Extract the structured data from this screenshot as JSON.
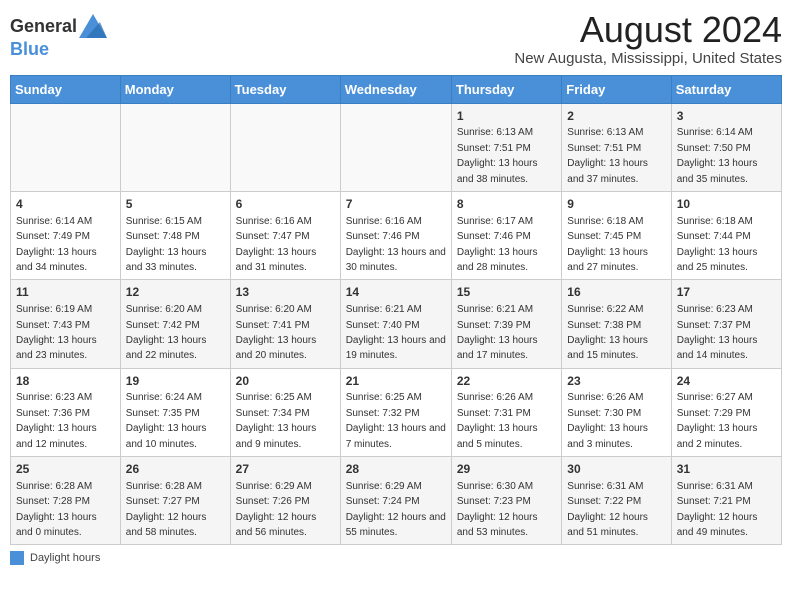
{
  "logo": {
    "line1": "General",
    "line2": "Blue"
  },
  "title": "August 2024",
  "subtitle": "New Augusta, Mississippi, United States",
  "days_of_week": [
    "Sunday",
    "Monday",
    "Tuesday",
    "Wednesday",
    "Thursday",
    "Friday",
    "Saturday"
  ],
  "weeks": [
    [
      {
        "day": "",
        "info": ""
      },
      {
        "day": "",
        "info": ""
      },
      {
        "day": "",
        "info": ""
      },
      {
        "day": "",
        "info": ""
      },
      {
        "day": "1",
        "info": "Sunrise: 6:13 AM\nSunset: 7:51 PM\nDaylight: 13 hours and 38 minutes."
      },
      {
        "day": "2",
        "info": "Sunrise: 6:13 AM\nSunset: 7:51 PM\nDaylight: 13 hours and 37 minutes."
      },
      {
        "day": "3",
        "info": "Sunrise: 6:14 AM\nSunset: 7:50 PM\nDaylight: 13 hours and 35 minutes."
      }
    ],
    [
      {
        "day": "4",
        "info": "Sunrise: 6:14 AM\nSunset: 7:49 PM\nDaylight: 13 hours and 34 minutes."
      },
      {
        "day": "5",
        "info": "Sunrise: 6:15 AM\nSunset: 7:48 PM\nDaylight: 13 hours and 33 minutes."
      },
      {
        "day": "6",
        "info": "Sunrise: 6:16 AM\nSunset: 7:47 PM\nDaylight: 13 hours and 31 minutes."
      },
      {
        "day": "7",
        "info": "Sunrise: 6:16 AM\nSunset: 7:46 PM\nDaylight: 13 hours and 30 minutes."
      },
      {
        "day": "8",
        "info": "Sunrise: 6:17 AM\nSunset: 7:46 PM\nDaylight: 13 hours and 28 minutes."
      },
      {
        "day": "9",
        "info": "Sunrise: 6:18 AM\nSunset: 7:45 PM\nDaylight: 13 hours and 27 minutes."
      },
      {
        "day": "10",
        "info": "Sunrise: 6:18 AM\nSunset: 7:44 PM\nDaylight: 13 hours and 25 minutes."
      }
    ],
    [
      {
        "day": "11",
        "info": "Sunrise: 6:19 AM\nSunset: 7:43 PM\nDaylight: 13 hours and 23 minutes."
      },
      {
        "day": "12",
        "info": "Sunrise: 6:20 AM\nSunset: 7:42 PM\nDaylight: 13 hours and 22 minutes."
      },
      {
        "day": "13",
        "info": "Sunrise: 6:20 AM\nSunset: 7:41 PM\nDaylight: 13 hours and 20 minutes."
      },
      {
        "day": "14",
        "info": "Sunrise: 6:21 AM\nSunset: 7:40 PM\nDaylight: 13 hours and 19 minutes."
      },
      {
        "day": "15",
        "info": "Sunrise: 6:21 AM\nSunset: 7:39 PM\nDaylight: 13 hours and 17 minutes."
      },
      {
        "day": "16",
        "info": "Sunrise: 6:22 AM\nSunset: 7:38 PM\nDaylight: 13 hours and 15 minutes."
      },
      {
        "day": "17",
        "info": "Sunrise: 6:23 AM\nSunset: 7:37 PM\nDaylight: 13 hours and 14 minutes."
      }
    ],
    [
      {
        "day": "18",
        "info": "Sunrise: 6:23 AM\nSunset: 7:36 PM\nDaylight: 13 hours and 12 minutes."
      },
      {
        "day": "19",
        "info": "Sunrise: 6:24 AM\nSunset: 7:35 PM\nDaylight: 13 hours and 10 minutes."
      },
      {
        "day": "20",
        "info": "Sunrise: 6:25 AM\nSunset: 7:34 PM\nDaylight: 13 hours and 9 minutes."
      },
      {
        "day": "21",
        "info": "Sunrise: 6:25 AM\nSunset: 7:32 PM\nDaylight: 13 hours and 7 minutes."
      },
      {
        "day": "22",
        "info": "Sunrise: 6:26 AM\nSunset: 7:31 PM\nDaylight: 13 hours and 5 minutes."
      },
      {
        "day": "23",
        "info": "Sunrise: 6:26 AM\nSunset: 7:30 PM\nDaylight: 13 hours and 3 minutes."
      },
      {
        "day": "24",
        "info": "Sunrise: 6:27 AM\nSunset: 7:29 PM\nDaylight: 13 hours and 2 minutes."
      }
    ],
    [
      {
        "day": "25",
        "info": "Sunrise: 6:28 AM\nSunset: 7:28 PM\nDaylight: 13 hours and 0 minutes."
      },
      {
        "day": "26",
        "info": "Sunrise: 6:28 AM\nSunset: 7:27 PM\nDaylight: 12 hours and 58 minutes."
      },
      {
        "day": "27",
        "info": "Sunrise: 6:29 AM\nSunset: 7:26 PM\nDaylight: 12 hours and 56 minutes."
      },
      {
        "day": "28",
        "info": "Sunrise: 6:29 AM\nSunset: 7:24 PM\nDaylight: 12 hours and 55 minutes."
      },
      {
        "day": "29",
        "info": "Sunrise: 6:30 AM\nSunset: 7:23 PM\nDaylight: 12 hours and 53 minutes."
      },
      {
        "day": "30",
        "info": "Sunrise: 6:31 AM\nSunset: 7:22 PM\nDaylight: 12 hours and 51 minutes."
      },
      {
        "day": "31",
        "info": "Sunrise: 6:31 AM\nSunset: 7:21 PM\nDaylight: 12 hours and 49 minutes."
      }
    ]
  ],
  "legend_label": "Daylight hours",
  "accent_color": "#4a90d9"
}
